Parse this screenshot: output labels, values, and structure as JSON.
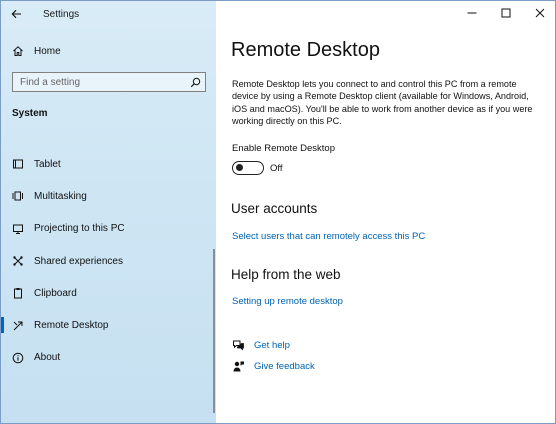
{
  "window": {
    "title": "Settings"
  },
  "sidebar": {
    "home_label": "Home",
    "search_placeholder": "Find a setting",
    "section_title": "System",
    "items": [
      {
        "label": "Tablet",
        "icon": "tablet-icon",
        "active": false
      },
      {
        "label": "Multitasking",
        "icon": "multitasking-icon",
        "active": false
      },
      {
        "label": "Projecting to this PC",
        "icon": "projecting-icon",
        "active": false
      },
      {
        "label": "Shared experiences",
        "icon": "shared-experiences-icon",
        "active": false
      },
      {
        "label": "Clipboard",
        "icon": "clipboard-icon",
        "active": false
      },
      {
        "label": "Remote Desktop",
        "icon": "remote-desktop-icon",
        "active": true
      },
      {
        "label": "About",
        "icon": "info-icon",
        "active": false
      }
    ]
  },
  "main": {
    "title": "Remote Desktop",
    "description": "Remote Desktop lets you connect to and control this PC from a remote device by using a Remote Desktop client (available for Windows, Android, iOS and macOS). You'll be able to work from another device as if you were working directly on this PC.",
    "toggle": {
      "label": "Enable Remote Desktop",
      "state_text": "Off",
      "on": false
    },
    "user_accounts": {
      "heading": "User accounts",
      "link": "Select users that can remotely access this PC"
    },
    "help": {
      "heading": "Help from the web",
      "link": "Setting up remote desktop"
    },
    "get_help": "Get help",
    "give_feedback": "Give feedback"
  },
  "colors": {
    "accent": "#0067c0",
    "link": "#0063b1",
    "sidebar_bg": "#d9ecf7"
  }
}
